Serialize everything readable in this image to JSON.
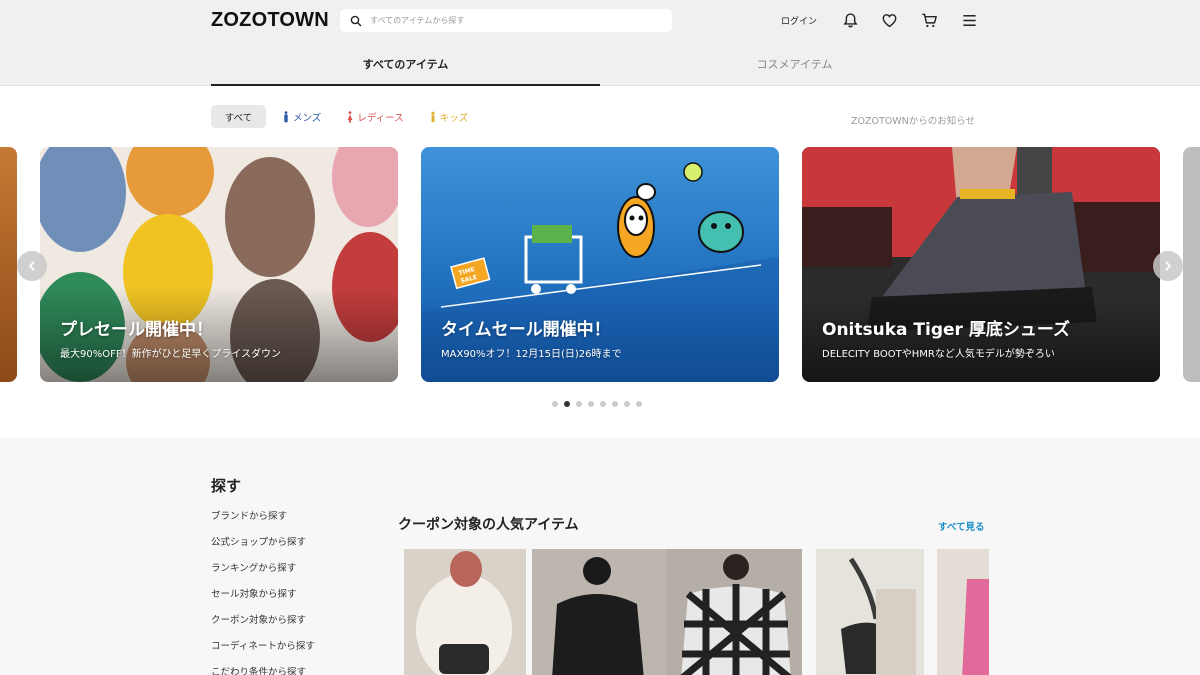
{
  "header": {
    "logo": "ZOZOTOWN",
    "search_placeholder": "すべてのアイテムから探す",
    "login": "ログイン",
    "icons": [
      "bell-icon",
      "heart-icon",
      "cart-icon",
      "menu-icon"
    ]
  },
  "tabs": [
    {
      "label": "すべてのアイテム",
      "active": true
    },
    {
      "label": "コスメアイテム",
      "active": false
    }
  ],
  "filters": [
    {
      "label": "すべて",
      "color": "#222222"
    },
    {
      "label": "メンズ",
      "color": "#2f5aa8"
    },
    {
      "label": "レディース",
      "color": "#d9534f"
    },
    {
      "label": "キッズ",
      "color": "#e0b030"
    }
  ],
  "news_link": "ZOZOTOWNからのお知らせ",
  "banners": [
    {
      "title": "プレセール開催中！",
      "subtitle": "最大90%OFF！新作がひと足早くプライスダウン"
    },
    {
      "title": "タイムセール開催中！",
      "subtitle": "MAX90%オフ！12月15日(日)26時まで",
      "badge": "TIME SALE"
    },
    {
      "title": "Onitsuka Tiger 厚底シューズ",
      "subtitle": "DELECITY BOOTやHMRなど人気モデルが勢ぞろい"
    }
  ],
  "carousel": {
    "total": 8,
    "active": 1
  },
  "sidebar": {
    "title": "探す",
    "items": [
      "ブランドから探す",
      "公式ショップから探す",
      "ランキングから探す",
      "セール対象から探す",
      "クーポン対象から探す",
      "コーディネートから探す",
      "こだわり条件から探す"
    ]
  },
  "section": {
    "title": "クーポン対象の人気アイテム",
    "see_all": "すべて見る"
  }
}
